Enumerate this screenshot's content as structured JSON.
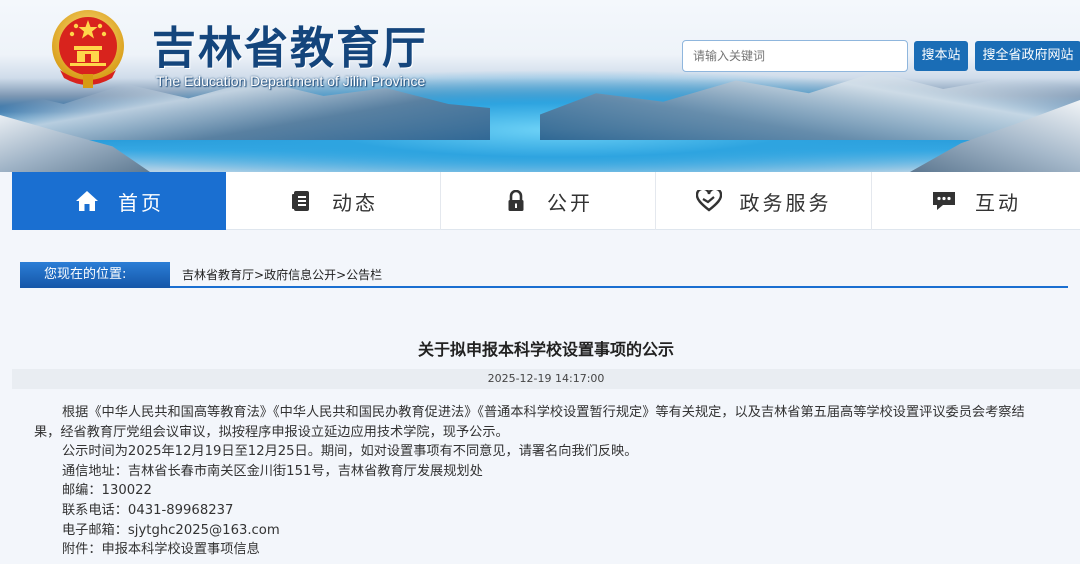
{
  "header": {
    "title": "吉林省教育厅",
    "subtitle": "The Education Department of Jilin Province",
    "search_placeholder": "请输入关键词",
    "search_site_label": "搜本站",
    "search_gov_label": "搜全省政府网站"
  },
  "nav": {
    "items": [
      {
        "label": "首页",
        "icon": "home-icon"
      },
      {
        "label": "动态",
        "icon": "document-icon"
      },
      {
        "label": "公开",
        "icon": "lock-icon"
      },
      {
        "label": "政务服务",
        "icon": "handshake-heart-icon"
      },
      {
        "label": "互动",
        "icon": "chat-icon"
      }
    ],
    "active_index": 0
  },
  "breadcrumb": {
    "label": "您现在的位置:",
    "items": [
      "吉林省教育厅",
      "政府信息公开",
      "公告栏"
    ],
    "separator": ">"
  },
  "article": {
    "title": "关于拟申报本科学校设置事项的公示",
    "date": "2025-12-19 14:17:00",
    "paragraph1": "根据《中华人民共和国高等教育法》《中华人民共和国民办教育促进法》《普通本科学校设置暂行规定》等有关规定，以及吉林省第五届高等学校设置评议委员会考察结果，经省教育厅党组会议审议，拟按程序申报设立延边应用技术学院，现予公示。",
    "paragraph2": "公示时间为2025年12月19日至12月25日。期间，如对设置事项有不同意见，请署名向我们反映。",
    "address": "通信地址：吉林省长春市南关区金川街151号，吉林省教育厅发展规划处",
    "postcode": "邮编：130022",
    "phone": "联系电话：0431-89968237",
    "email": "电子邮箱：sjytghc2025@163.com",
    "attachment": "附件：申报本科学校设置事项信息"
  },
  "colors": {
    "primary_blue": "#1a6fd1",
    "title_blue": "#14457c",
    "button_blue": "#1a6db6"
  }
}
